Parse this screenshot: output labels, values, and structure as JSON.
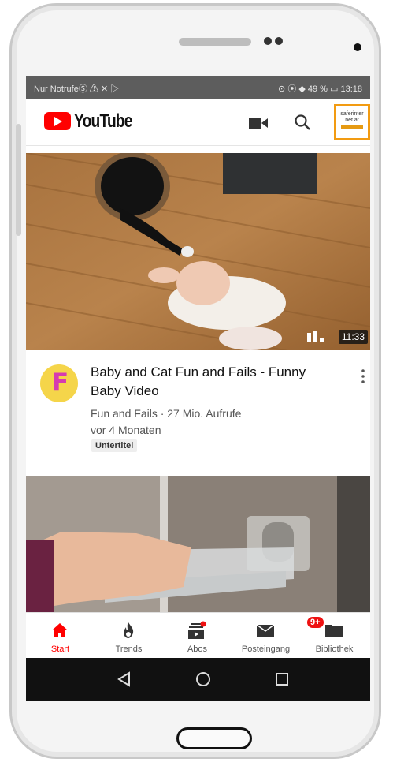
{
  "status_bar": {
    "carrier": "Nur NotrufeⓈ ⚠ ✕ ▷",
    "right": "⊙ ⦿ ◆ 49 % ▭ 13:18"
  },
  "header": {
    "brand": "YouTube",
    "avatar_text_lines": [
      "saferinter",
      "net.at"
    ]
  },
  "video1": {
    "duration": "11:33",
    "title": "Baby and Cat Fun and Fails - Funny Baby Video",
    "channel_line": "Fun and Fails · 27 Mio. Aufrufe",
    "age": "vor 4 Monaten",
    "badge": "Untertitel",
    "channel_initial": "F"
  },
  "nav": {
    "items": [
      {
        "label": "Start",
        "icon": "home-icon",
        "active": true
      },
      {
        "label": "Trends",
        "icon": "flame-icon",
        "active": false
      },
      {
        "label": "Abos",
        "icon": "subscriptions-icon",
        "active": false
      },
      {
        "label": "Posteingang",
        "icon": "inbox-icon",
        "active": false
      },
      {
        "label": "Bibliothek",
        "icon": "folder-icon",
        "active": false
      }
    ],
    "inbox_badge": "9+"
  },
  "colors": {
    "accent": "#ff0000",
    "avatar_border": "#f29b12"
  }
}
